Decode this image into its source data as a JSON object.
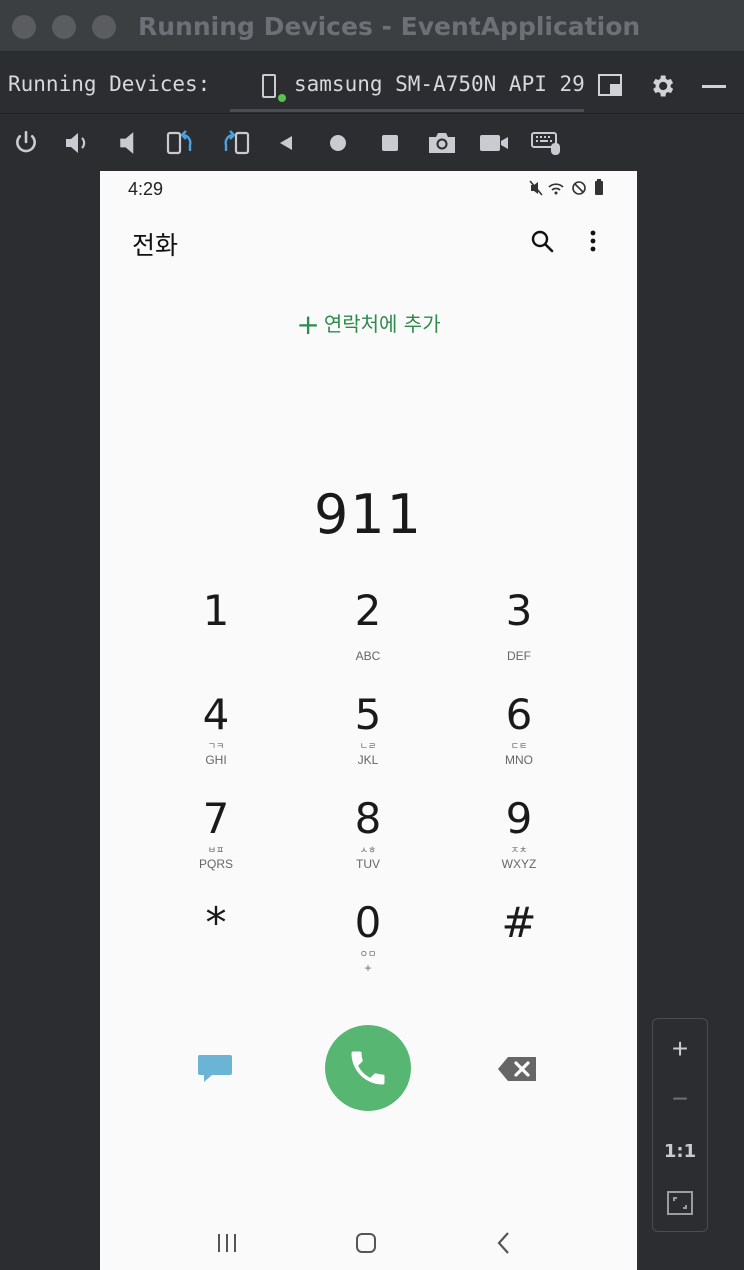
{
  "window": {
    "title": "Running Devices - EventApplication"
  },
  "panel": {
    "label": "Running Devices:",
    "device_tab": "samsung SM-A750N API 29"
  },
  "phone": {
    "status_time": "4:29",
    "app_title": "전화",
    "add_contact": "연락처에 추가",
    "dialed_number": "911",
    "keys": [
      {
        "digit": "1",
        "korean": "",
        "letters": ""
      },
      {
        "digit": "2",
        "korean": "",
        "letters": "ABC"
      },
      {
        "digit": "3",
        "korean": "",
        "letters": "DEF"
      },
      {
        "digit": "4",
        "korean": "ㄱㅋ",
        "letters": "GHI"
      },
      {
        "digit": "5",
        "korean": "ㄴㄹ",
        "letters": "JKL"
      },
      {
        "digit": "6",
        "korean": "ㄷㅌ",
        "letters": "MNO"
      },
      {
        "digit": "7",
        "korean": "ㅂㅍ",
        "letters": "PQRS"
      },
      {
        "digit": "8",
        "korean": "ㅅㅎ",
        "letters": "TUV"
      },
      {
        "digit": "9",
        "korean": "ㅈㅊ",
        "letters": "WXYZ"
      },
      {
        "digit": "*",
        "korean": "",
        "letters": ""
      },
      {
        "digit": "0",
        "korean": "ㅇㅁ",
        "letters": "+"
      },
      {
        "digit": "#",
        "korean": "",
        "letters": ""
      }
    ]
  },
  "zoom": {
    "plus": "+",
    "minus": "−",
    "actual": "1:1"
  },
  "colors": {
    "accent_green": "#2e8b4e",
    "call_green": "#58b673",
    "message_blue": "#6bb4d6",
    "live_dot": "#58c24c"
  }
}
